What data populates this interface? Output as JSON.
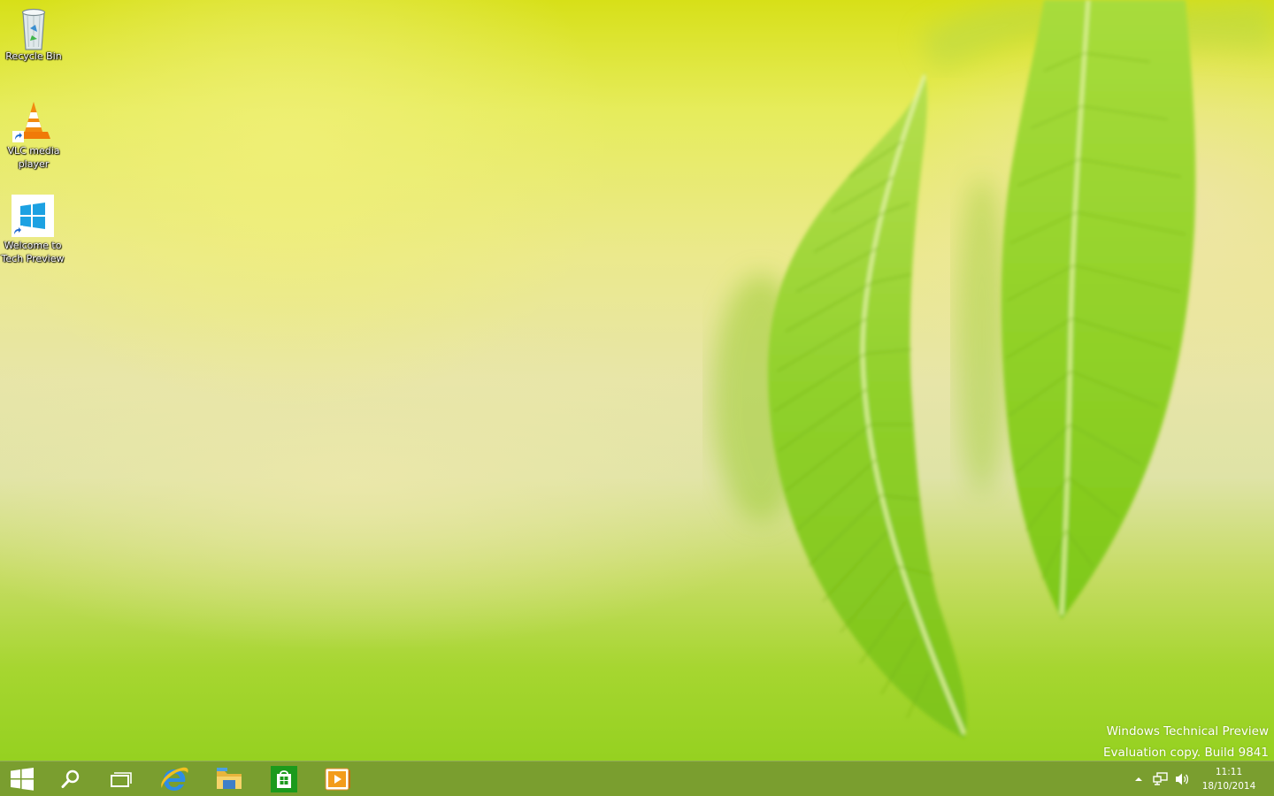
{
  "desktop": {
    "icons": [
      {
        "label": "Recycle Bin",
        "icon": "recycle-bin-icon"
      },
      {
        "label": "VLC media player",
        "icon": "vlc-icon"
      },
      {
        "label": "Welcome to Tech Preview",
        "icon": "windows-logo-icon"
      }
    ]
  },
  "watermark": {
    "line1": "Windows Technical Preview",
    "line2": "Evaluation copy. Build 9841"
  },
  "taskbar": {
    "buttons": [
      {
        "name": "start-button",
        "icon": "windows-logo-icon"
      },
      {
        "name": "search-button",
        "icon": "search-icon"
      },
      {
        "name": "task-view-button",
        "icon": "task-view-icon"
      },
      {
        "name": "internet-explorer-button",
        "icon": "internet-explorer-icon"
      },
      {
        "name": "file-explorer-button",
        "icon": "folder-icon"
      },
      {
        "name": "store-button",
        "icon": "store-icon"
      },
      {
        "name": "media-player-button",
        "icon": "media-player-icon"
      }
    ],
    "tray": {
      "icons": [
        "show-hidden-icons-icon",
        "network-icon",
        "volume-icon"
      ],
      "time": "11:11",
      "date": "18/10/2014"
    }
  },
  "colors": {
    "taskbar": "#789a30",
    "leaf": "#8ccb20",
    "store_green": "#1c9a1c"
  }
}
